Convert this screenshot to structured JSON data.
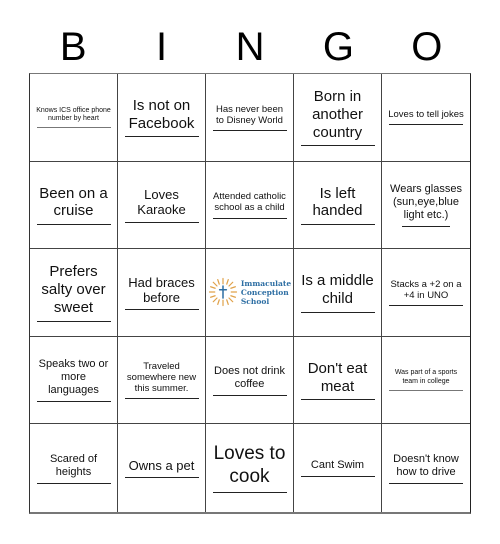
{
  "header": {
    "letters": [
      "B",
      "I",
      "N",
      "G",
      "O"
    ]
  },
  "colors": {
    "logo_sun": "#e0a24a",
    "logo_text": "#2d6ea3",
    "grid_line": "#444444"
  },
  "cells": [
    "Knows ICS office phone number by heart",
    "Is not on Facebook",
    "Has never been to Disney World",
    "Born in another country",
    "Loves to tell jokes",
    "Been on a cruise",
    "Loves Karaoke",
    "Attended catholic school as a child",
    "Is left handed",
    "Wears glasses (sun,eye,blue light etc.)",
    "Prefers salty over sweet",
    "Had braces before",
    "",
    "Is a middle child",
    "Stacks a +2 on a +4 in UNO",
    "Speaks two or more languages",
    "Traveled somewhere new this summer.",
    "Does not drink coffee",
    "Don't eat meat",
    "Was part of a sports team in college",
    "Scared of heights",
    "Owns a pet",
    "Loves to cook",
    "Cant Swim",
    "Doesn't know how to drive"
  ],
  "free_space": {
    "logo_icon": "cross-sun-icon",
    "logo_lines": [
      "Immaculate",
      "Conception",
      "School"
    ]
  }
}
